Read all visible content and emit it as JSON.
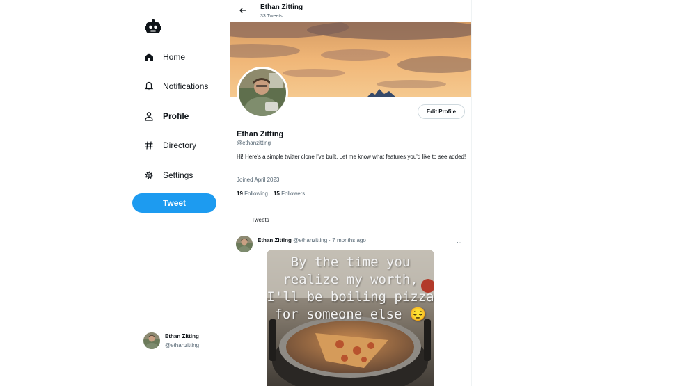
{
  "nav": {
    "items": [
      {
        "label": "Home",
        "icon": "home-icon"
      },
      {
        "label": "Notifications",
        "icon": "bell-icon"
      },
      {
        "label": "Profile",
        "icon": "person-icon"
      },
      {
        "label": "Directory",
        "icon": "hash-icon"
      },
      {
        "label": "Settings",
        "icon": "gear-icon"
      }
    ],
    "active": "Profile",
    "tweet_button": "Tweet"
  },
  "account": {
    "name": "Ethan Zitting",
    "handle": "@ethanzitting",
    "more": "..."
  },
  "header": {
    "name": "Ethan Zitting",
    "tweet_count": "33 Tweets"
  },
  "profile": {
    "name": "Ethan Zitting",
    "handle": "@ethanzitting",
    "bio": "Hi! Here's a simple twitter clone I've built. Let me know what features you'd like to see added!",
    "joined": "Joined April 2023",
    "following_count": "19",
    "following_label": "Following",
    "followers_count": "15",
    "followers_label": "Followers",
    "edit_button": "Edit Profile"
  },
  "tabs": {
    "tweets": "Tweets"
  },
  "tweet": {
    "author": "Ethan Zitting",
    "handle": "@ethanzitting",
    "separator": "·",
    "time": "7 months ago",
    "more": "...",
    "image_text": "By the time you\nrealize my worth,\nI'll be boiling pizza\nfor someone else 😔"
  },
  "colors": {
    "accent": "#1d9bf0",
    "text": "#0f1419",
    "muted": "#536471",
    "border": "#eff3f4"
  }
}
